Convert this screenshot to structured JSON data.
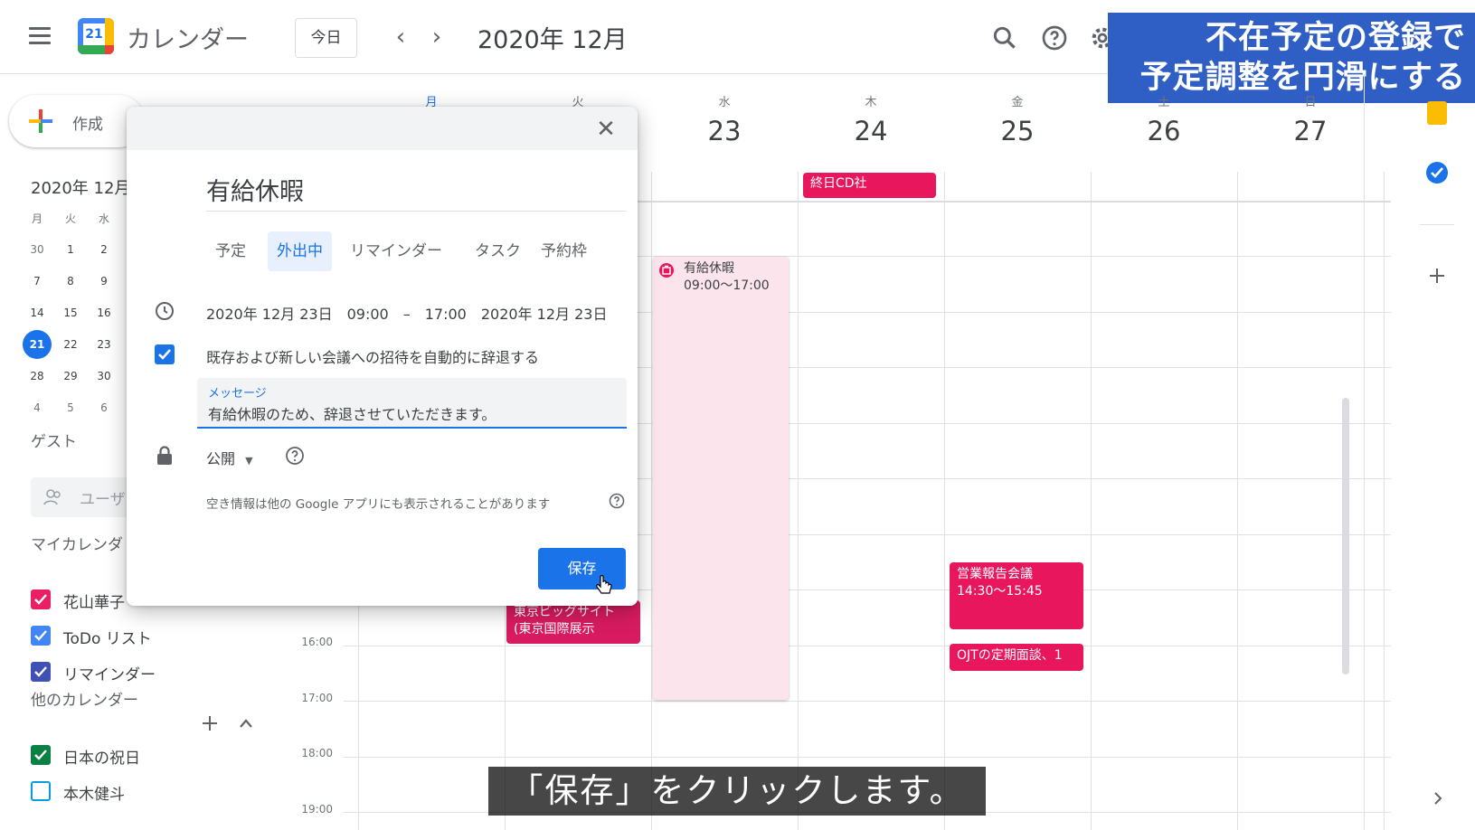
{
  "header": {
    "logo_day": "21",
    "app_title": "カレンダー",
    "today_button": "今日",
    "prev_label": "‹",
    "next_label": "›",
    "month_title": "2020年 12月"
  },
  "banner": {
    "line1": "不在予定の登録で",
    "line2": "予定調整を円滑にする"
  },
  "sidebar": {
    "create_label": "作成",
    "mini_title": "2020年 12月",
    "mini_dow": [
      "月",
      "火",
      "水"
    ],
    "mini_rows": [
      [
        "30",
        "1",
        "2"
      ],
      [
        "7",
        "8",
        "9"
      ],
      [
        "14",
        "15",
        "16"
      ],
      [
        "21",
        "22",
        "23"
      ],
      [
        "28",
        "29",
        "30"
      ],
      [
        "4",
        "5",
        "6"
      ]
    ],
    "guest_heading": "ゲスト",
    "guest_placeholder": "ユーザ",
    "my_calendars_heading": "マイカレンダ",
    "my_calendars": [
      {
        "label": "花山華子",
        "color": "#e91e63",
        "checked": true
      },
      {
        "label": "ToDo リスト",
        "color": "#4285f4",
        "checked": true
      },
      {
        "label": "リマインダー",
        "color": "#3f51b5",
        "checked": true
      }
    ],
    "other_calendars_heading": "他のカレンダー",
    "other_calendars": [
      {
        "label": "日本の祝日",
        "color": "#0b8043",
        "checked": true
      },
      {
        "label": "本木健斗",
        "color": "#039be5",
        "checked": false
      }
    ]
  },
  "week": {
    "days": [
      {
        "dow": "月",
        "date": ""
      },
      {
        "dow": "火",
        "date": ""
      },
      {
        "dow": "水",
        "date": "23"
      },
      {
        "dow": "木",
        "date": "24"
      },
      {
        "dow": "金",
        "date": "25"
      },
      {
        "dow": "土",
        "date": "26"
      },
      {
        "dow": "日",
        "date": "27"
      }
    ],
    "times": [
      "16:00",
      "17:00",
      "18:00",
      "19:00"
    ]
  },
  "events": {
    "allday": {
      "title": "終日CD社",
      "color": "#e8175d"
    },
    "vacation": {
      "title": "有給休暇",
      "time": "09:00〜17:00"
    },
    "sales": {
      "title": "営業報告会議",
      "time": "14:30〜15:45",
      "color": "#e8175d"
    },
    "ojt": {
      "title": "OJTの定期面談、1",
      "color": "#e8175d"
    },
    "bigsight": {
      "title": "東京ビッグサイト",
      "subtitle": "(東京国際展示",
      "color": "#d81b60"
    }
  },
  "dialog": {
    "title": "有給休暇",
    "tabs": [
      "予定",
      "外出中",
      "リマインダー",
      "タスク",
      "予約枠"
    ],
    "active_tab": "外出中",
    "datetime": "2020年 12月 23日　09:00　–　17:00　2020年 12月 23日",
    "decline_checkbox_label": "既存および新しい会議への招待を自動的に辞退する",
    "message_label": "メッセージ",
    "message_value": "有給休暇のため、辞退させていただきます。",
    "visibility": "公開",
    "availability_note": "空き情報は他の Google アプリにも表示されることがあります",
    "save_button": "保存"
  },
  "caption": "「保存」をクリックします。",
  "colors": {
    "accent": "#1a73e8",
    "event": "#e8175d",
    "vacation_bg": "#fce4ec"
  }
}
